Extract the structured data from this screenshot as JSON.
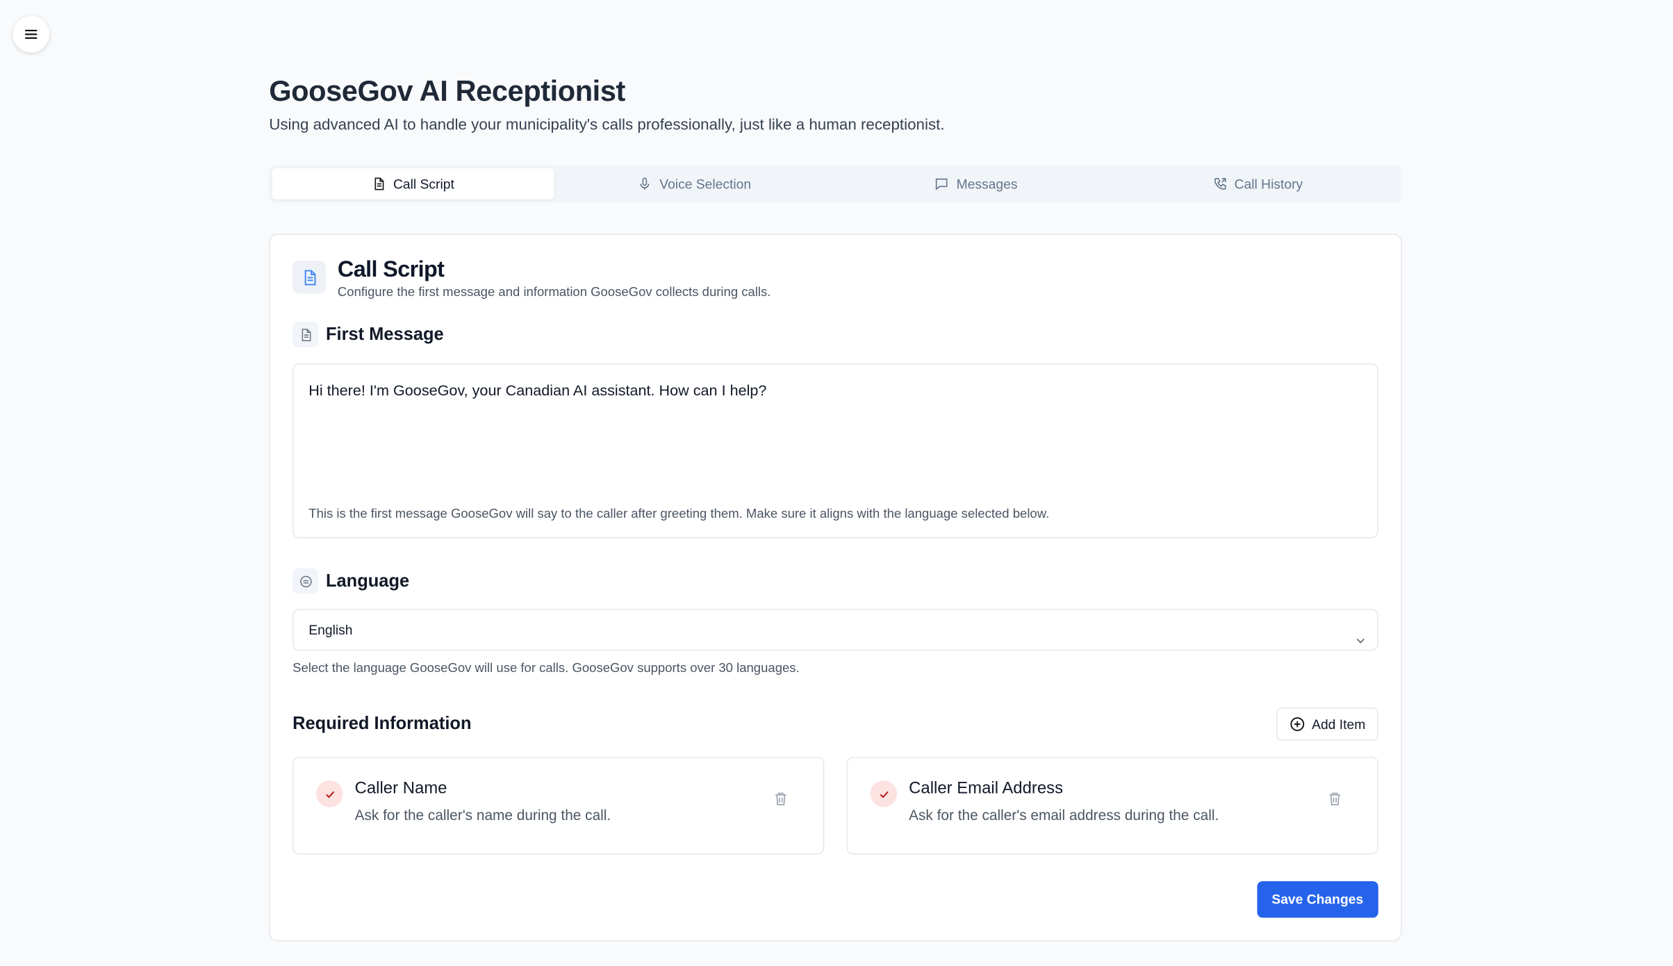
{
  "header": {
    "title": "GooseGov AI Receptionist",
    "subtitle": "Using advanced AI to handle your municipality's calls professionally, just like a human receptionist."
  },
  "tabs": [
    {
      "label": "Call Script",
      "icon": "document-icon",
      "active": true
    },
    {
      "label": "Voice Selection",
      "icon": "microphone-icon",
      "active": false
    },
    {
      "label": "Messages",
      "icon": "message-icon",
      "active": false
    },
    {
      "label": "Call History",
      "icon": "phone-icon",
      "active": false
    }
  ],
  "card": {
    "title": "Call Script",
    "description": "Configure the first message and information GooseGov collects during calls."
  },
  "first_message": {
    "title": "First Message",
    "value": "Hi there! I'm GooseGov, your Canadian AI assistant. How can I help?",
    "hint": "This is the first message GooseGov will say to the caller after greeting them. Make sure it aligns with the language selected below."
  },
  "language": {
    "title": "Language",
    "selected": "English",
    "hint": "Select the language GooseGov will use for calls. GooseGov supports over 30 languages."
  },
  "required_info": {
    "title": "Required Information",
    "add_label": "Add Item",
    "items": [
      {
        "title": "Caller Name",
        "description": "Ask for the caller's name during the call."
      },
      {
        "title": "Caller Email Address",
        "description": "Ask for the caller's email address during the call."
      }
    ]
  },
  "save_label": "Save Changes",
  "colors": {
    "accent": "#2563eb",
    "background": "#f8fafc",
    "check_bg": "#fde2e2"
  }
}
